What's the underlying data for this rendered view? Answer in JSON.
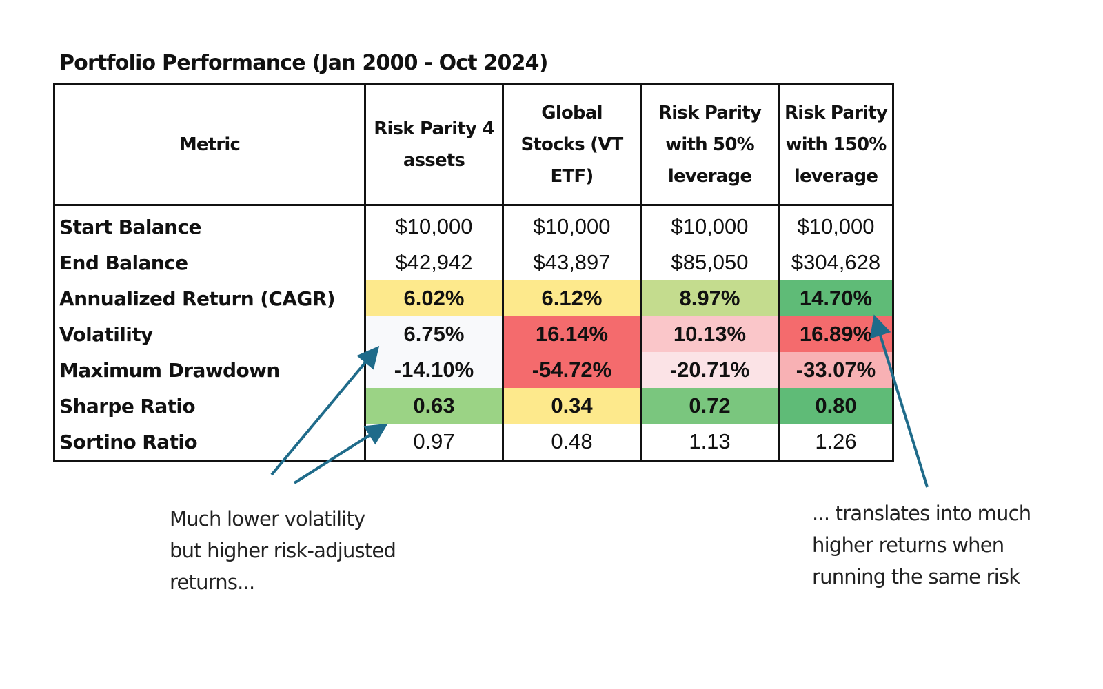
{
  "title": "Portfolio Performance (Jan 2000 - Oct 2024)",
  "table": {
    "headers": [
      "Metric",
      "Risk Parity 4 assets",
      "Global Stocks (VT ETF)",
      "Risk Parity with 50% leverage",
      "Risk Parity with 150% leverage"
    ],
    "header_lines": [
      [
        "Metric"
      ],
      [
        "Risk Parity 4",
        "assets"
      ],
      [
        "Global",
        "Stocks (VT",
        "ETF)"
      ],
      [
        "Risk Parity",
        "with 50%",
        "leverage"
      ],
      [
        "Risk Parity",
        "with 150%",
        "leverage"
      ]
    ],
    "rows": [
      {
        "metric": "Start Balance",
        "bold": false,
        "values": [
          "$10,000",
          "$10,000",
          "$10,000",
          "$10,000"
        ],
        "colors": [
          "#ffffff",
          "#ffffff",
          "#ffffff",
          "#ffffff"
        ]
      },
      {
        "metric": "End Balance",
        "bold": false,
        "values": [
          "$42,942",
          "$43,897",
          "$85,050",
          "$304,628"
        ],
        "colors": [
          "#ffffff",
          "#ffffff",
          "#ffffff",
          "#ffffff"
        ]
      },
      {
        "metric": "Annualized Return (CAGR)",
        "bold": true,
        "values": [
          "6.02%",
          "6.12%",
          "8.97%",
          "14.70%"
        ],
        "colors": [
          "#fde98c",
          "#fde98c",
          "#c4dc8e",
          "#5fbb77"
        ]
      },
      {
        "metric": "Volatility",
        "bold": true,
        "values": [
          "6.75%",
          "16.14%",
          "10.13%",
          "16.89%"
        ],
        "colors": [
          "#f8f9fb",
          "#f46b6d",
          "#fac6c9",
          "#f46b6d"
        ]
      },
      {
        "metric": "Maximum Drawdown",
        "bold": true,
        "values": [
          "-14.10%",
          "-54.72%",
          "-20.71%",
          "-33.07%"
        ],
        "colors": [
          "#f8f9fb",
          "#f46b6d",
          "#fbe3e6",
          "#f8b1b4"
        ]
      },
      {
        "metric": "Sharpe Ratio",
        "bold": true,
        "values": [
          "0.63",
          "0.34",
          "0.72",
          "0.80"
        ],
        "colors": [
          "#9bd385",
          "#fde98c",
          "#7ac67e",
          "#5fbb77"
        ]
      },
      {
        "metric": "Sortino Ratio",
        "bold": false,
        "values": [
          "0.97",
          "0.48",
          "1.13",
          "1.26"
        ],
        "colors": [
          "#ffffff",
          "#ffffff",
          "#ffffff",
          "#ffffff"
        ]
      }
    ]
  },
  "annotations": {
    "left": "Much lower volatility\nbut higher risk-adjusted\nreturns...",
    "right": "... translates into much\nhigher returns when\nrunning the same risk"
  },
  "colors": {
    "arrow": "#1f6b8a",
    "border": "#111111"
  }
}
